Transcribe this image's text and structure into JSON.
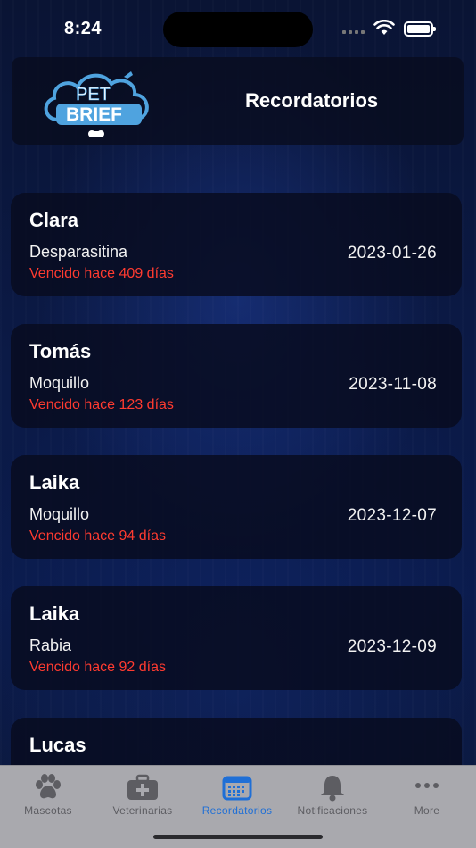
{
  "status": {
    "time": "8:24"
  },
  "header": {
    "title": "Recordatorios",
    "logo_line1": "PET",
    "logo_line2": "BRIEF"
  },
  "reminders": [
    {
      "pet": "Clara",
      "vaccine": "Desparasitina",
      "date": "2023-01-26",
      "status": "Vencido hace 409 días"
    },
    {
      "pet": "Tomás",
      "vaccine": "Moquillo",
      "date": "2023-11-08",
      "status": "Vencido hace 123 días"
    },
    {
      "pet": "Laika",
      "vaccine": "Moquillo",
      "date": "2023-12-07",
      "status": "Vencido hace 94 días"
    },
    {
      "pet": "Laika",
      "vaccine": "Rabia",
      "date": "2023-12-09",
      "status": "Vencido hace 92 días"
    },
    {
      "pet": "Lucas"
    }
  ],
  "tabs": [
    {
      "label": "Mascotas",
      "icon": "paw-icon"
    },
    {
      "label": "Veterinarias",
      "icon": "medical-kit-icon"
    },
    {
      "label": "Recordatorios",
      "icon": "calendar-icon",
      "active": true
    },
    {
      "label": "Notificaciones",
      "icon": "bell-icon"
    },
    {
      "label": "More",
      "icon": "more-icon"
    }
  ],
  "colors": {
    "accent": "#1f6fd6",
    "overdue": "#ff3b30",
    "tab_inactive": "#5d5d62"
  }
}
